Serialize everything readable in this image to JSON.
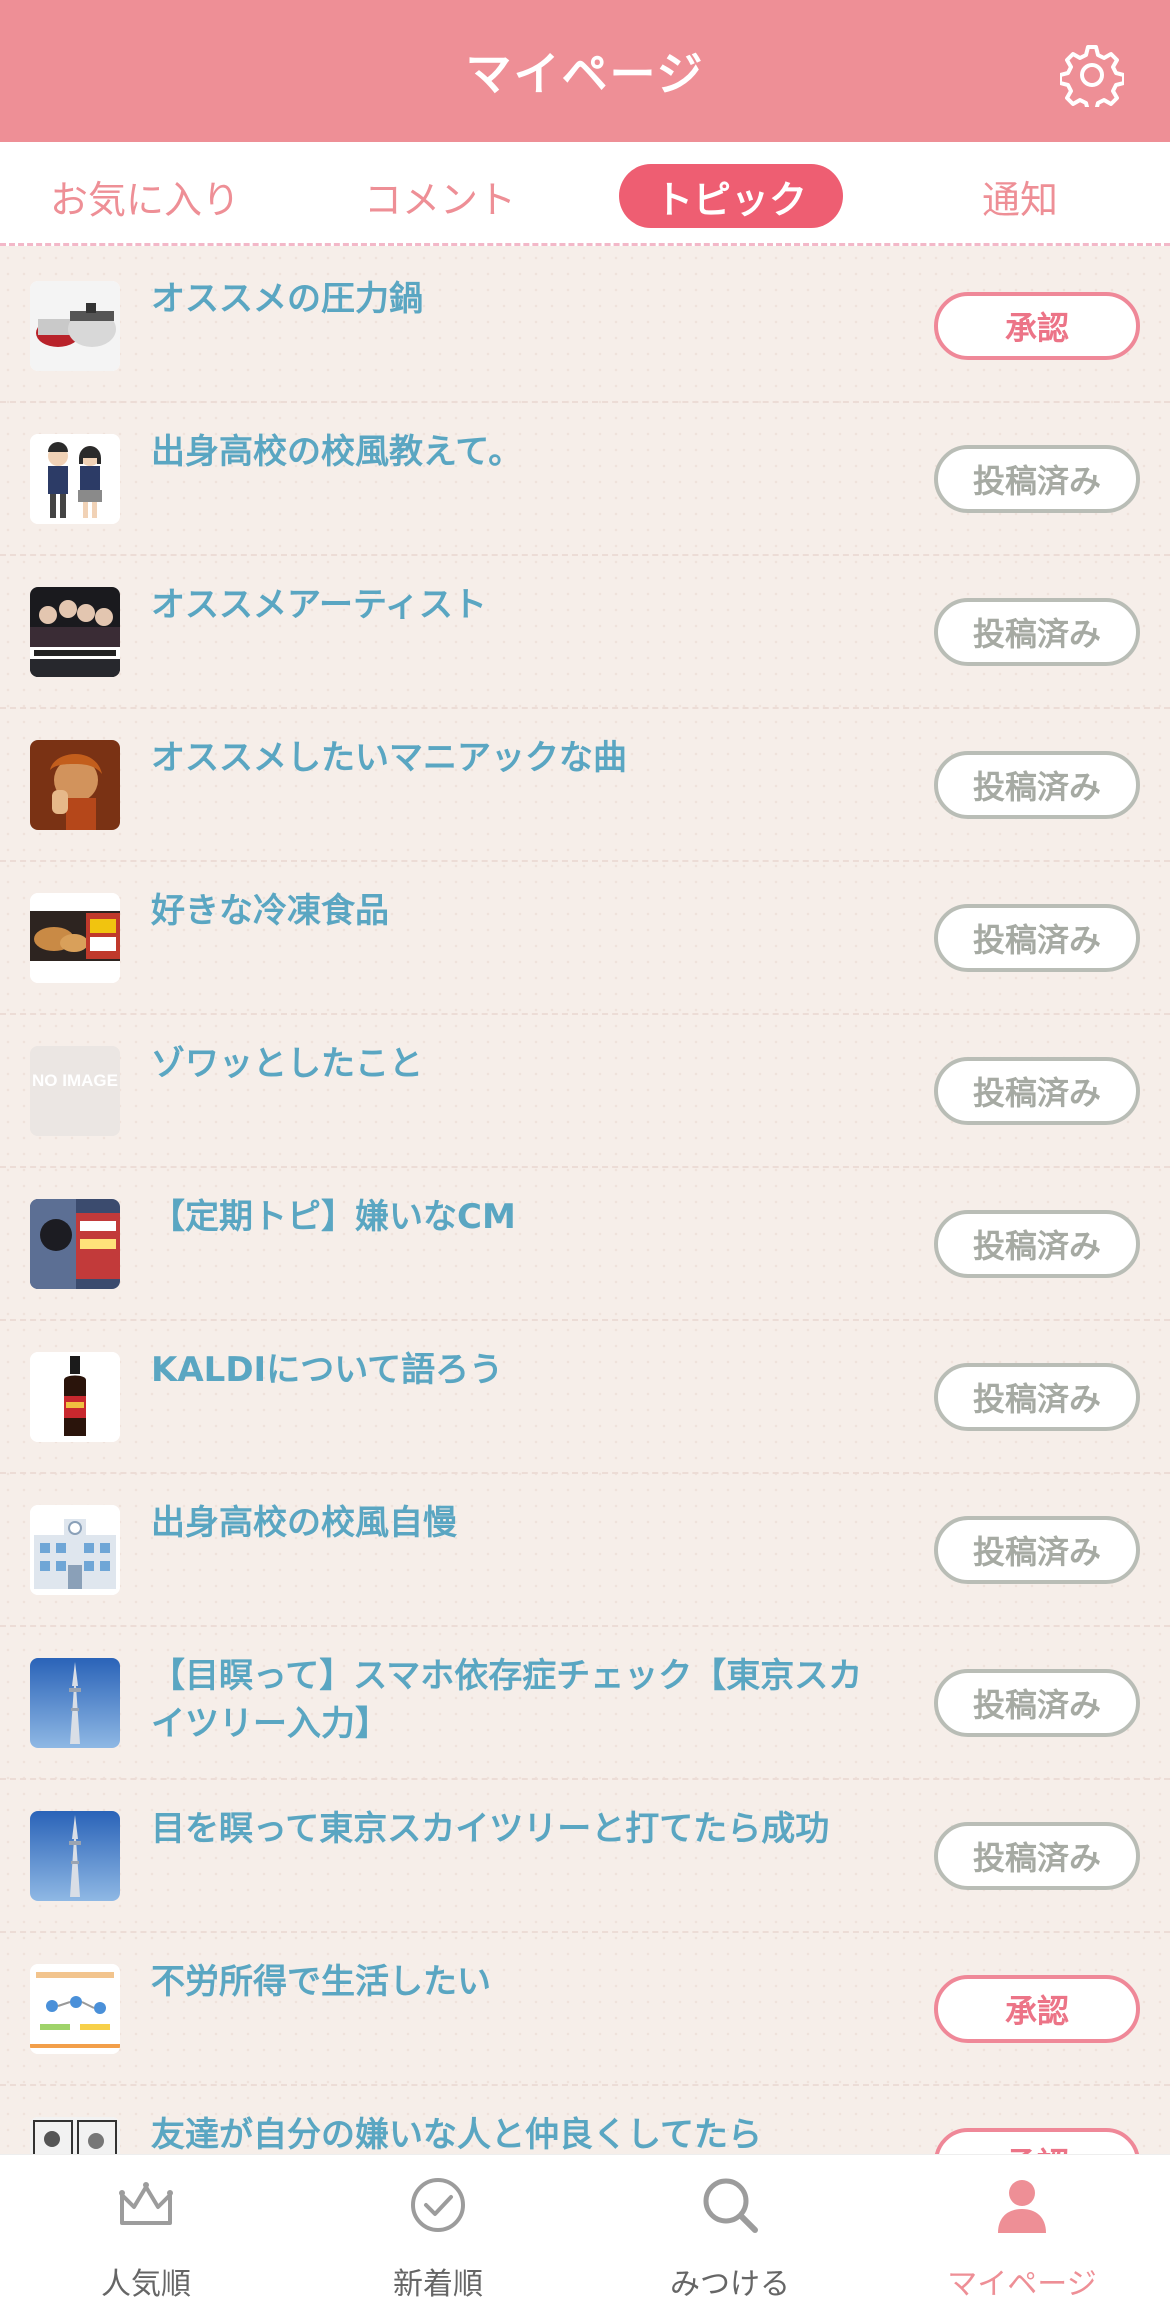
{
  "header": {
    "title": "マイページ",
    "settings_icon": "gear-icon"
  },
  "tabs": [
    {
      "label": "お気に入り",
      "active": false
    },
    {
      "label": "コメント",
      "active": false
    },
    {
      "label": "トピック",
      "active": true
    },
    {
      "label": "通知",
      "active": false
    }
  ],
  "topics": [
    {
      "title": "オススメの圧力鍋",
      "status": "承認",
      "thumb": "pressure-cooker"
    },
    {
      "title": "出身高校の校風教えて。",
      "status": "投稿済み",
      "thumb": "students"
    },
    {
      "title": "オススメアーティスト",
      "status": "投稿済み",
      "thumb": "band-photo"
    },
    {
      "title": "オススメしたいマニアックな曲",
      "status": "投稿済み",
      "thumb": "singer-photo"
    },
    {
      "title": "好きな冷凍食品",
      "status": "投稿済み",
      "thumb": "frozen-food"
    },
    {
      "title": "ゾワッとしたこと",
      "status": "投稿済み",
      "thumb": "no-image",
      "thumb_text": "NO IMAGE"
    },
    {
      "title": "【定期トピ】嫌いなCM",
      "status": "投稿済み",
      "thumb": "cm-photo"
    },
    {
      "title": "KALDIについて語ろう",
      "status": "投稿済み",
      "thumb": "bottle"
    },
    {
      "title": "出身高校の校風自慢",
      "status": "投稿済み",
      "thumb": "school-building"
    },
    {
      "title": "【目瞑って】スマホ依存症チェック【東京スカイツリー入力】",
      "status": "投稿済み",
      "thumb": "skytree"
    },
    {
      "title": "目を瞑って東京スカイツリーと打てたら成功",
      "status": "投稿済み",
      "thumb": "skytree"
    },
    {
      "title": "不労所得で生活したい",
      "status": "承認",
      "thumb": "diagram"
    },
    {
      "title": "友達が自分の嫌いな人と仲良くしてたら",
      "status": "承認",
      "thumb": "manga"
    }
  ],
  "bottom_nav": [
    {
      "label": "人気順",
      "icon": "crown-icon",
      "active": false
    },
    {
      "label": "新着順",
      "icon": "clock-icon",
      "active": false
    },
    {
      "label": "みつける",
      "icon": "search-icon",
      "active": false
    },
    {
      "label": "マイページ",
      "icon": "person-icon",
      "active": true
    }
  ],
  "colors": {
    "header": "#ee8f96",
    "active_tab": "#ee5e72",
    "title_text": "#5aa6c2",
    "approve": "#ef8898",
    "posted": "#b9bdb6"
  }
}
